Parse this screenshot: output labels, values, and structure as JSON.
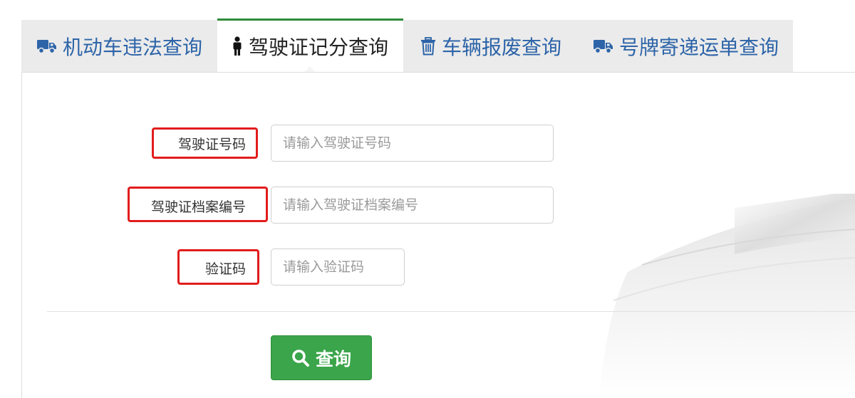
{
  "colors": {
    "tab_text": "#2d64a8",
    "active_tab_accent": "#2e8b3a",
    "highlight_box": "#e21c1c",
    "button_bg": "#3aa54a"
  },
  "tabs": [
    {
      "label": "机动车违法查询",
      "icon": "truck-icon",
      "active": false
    },
    {
      "label": "驾驶证记分查询",
      "icon": "person-icon",
      "active": true
    },
    {
      "label": "车辆报废查询",
      "icon": "trash-icon",
      "active": false
    },
    {
      "label": "号牌寄递运单查询",
      "icon": "truck-icon",
      "active": false
    }
  ],
  "form": {
    "license_number": {
      "label": "驾驶证号码",
      "placeholder": "请输入驾驶证号码",
      "value": ""
    },
    "archive_number": {
      "label": "驾驶证档案编号",
      "placeholder": "请输入驾驶证档案编号",
      "value": ""
    },
    "captcha": {
      "label": "验证码",
      "placeholder": "请输入验证码",
      "value": ""
    }
  },
  "submit": {
    "label": "查询",
    "icon": "search-icon"
  }
}
